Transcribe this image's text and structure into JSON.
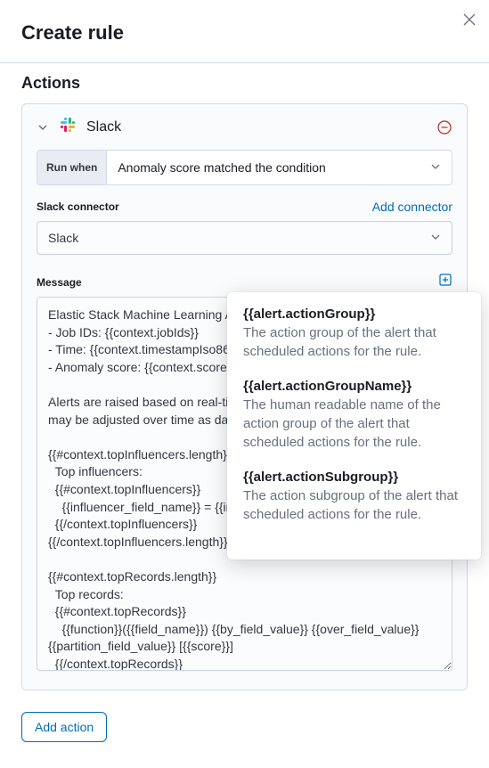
{
  "header": {
    "title": "Create rule"
  },
  "actions": {
    "section_title": "Actions",
    "slack": {
      "name": "Slack",
      "run_when_label": "Run when",
      "run_when_value": "Anomaly score matched the condition",
      "connector_label": "Slack connector",
      "add_connector": "Add connector",
      "connector_value": "Slack",
      "message_label": "Message",
      "message_value": "Elastic Stack Machine Learning Alert:\n- Job IDs: {{context.jobIds}}\n- Time: {{context.timestampIso8601}}\n- Anomaly score: {{context.score}}\n\nAlerts are raised based on real-time scores. Remember that scores may be adjusted over time as data continues to be analyzed.\n\n{{#context.topInfluencers.length}}\n  Top influencers:\n  {{#context.topInfluencers}}\n    {{influencer_field_name}} = {{influencer_field_value}} [{{score}}]\n  {{/context.topInfluencers}}\n{{/context.topInfluencers.length}}\n\n{{#context.topRecords.length}}\n  Top records:\n  {{#context.topRecords}}\n    {{function}}({{field_name}}) {{by_field_value}} {{over_field_value}} {{partition_field_value}} [{{score}}]\n  {{/context.topRecords}}\n{{/context.topRecords.length}}"
    },
    "add_action": "Add action"
  },
  "tooltip": {
    "items": [
      {
        "var": "{{alert.actionGroup}}",
        "desc": "The action group of the alert that scheduled actions for the rule."
      },
      {
        "var": "{{alert.actionGroupName}}",
        "desc": "The human readable name of the action group of the alert that scheduled actions for the rule."
      },
      {
        "var": "{{alert.actionSubgroup}}",
        "desc": "The action subgroup of the alert that scheduled actions for the rule."
      }
    ]
  }
}
